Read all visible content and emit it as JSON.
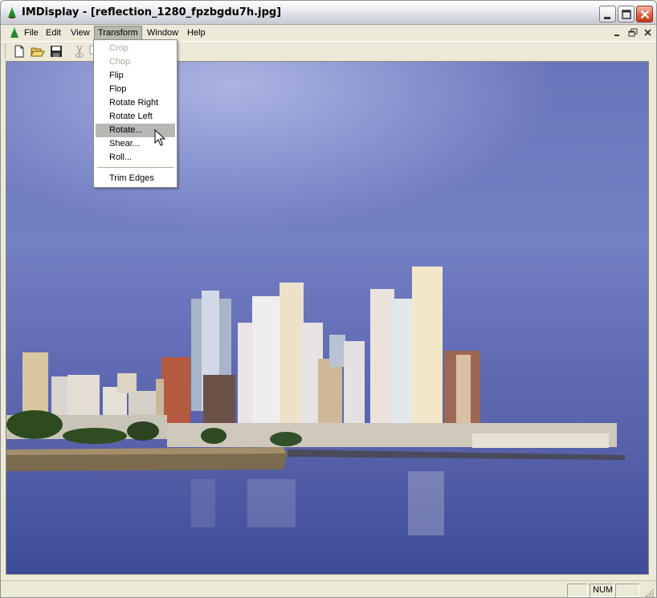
{
  "window": {
    "title": "IMDisplay - [reflection_1280_fpzbgdu7h.jpg]",
    "app_icon": "imagemagick-wizard-icon"
  },
  "menubar": {
    "items": [
      "File",
      "Edit",
      "View",
      "Transform",
      "Window",
      "Help"
    ],
    "active": "Transform"
  },
  "toolbar": {
    "buttons": [
      "new-document-icon",
      "open-folder-icon",
      "save-disk-icon",
      "cut-scissors-icon",
      "copy-icon"
    ]
  },
  "transform_menu": {
    "items": [
      {
        "label": "Crop",
        "enabled": false
      },
      {
        "label": "Chop",
        "enabled": false
      },
      {
        "label": "Flip",
        "enabled": true
      },
      {
        "label": "Flop",
        "enabled": true
      },
      {
        "label": "Rotate Right",
        "enabled": true
      },
      {
        "label": "Rotate Left",
        "enabled": true
      },
      {
        "label": "Rotate...",
        "enabled": true,
        "highlighted": true
      },
      {
        "label": "Shear...",
        "enabled": true
      },
      {
        "label": "Roll...",
        "enabled": true
      },
      {
        "label": "Trim Edges",
        "enabled": true
      }
    ]
  },
  "statusbar": {
    "panels": [
      "",
      "NUM",
      ""
    ]
  },
  "colors": {
    "sky": "#5d67b0",
    "sea": "#4b56a0",
    "menu_highlight": "#b7b7b4",
    "disabled_text": "#aca899"
  }
}
